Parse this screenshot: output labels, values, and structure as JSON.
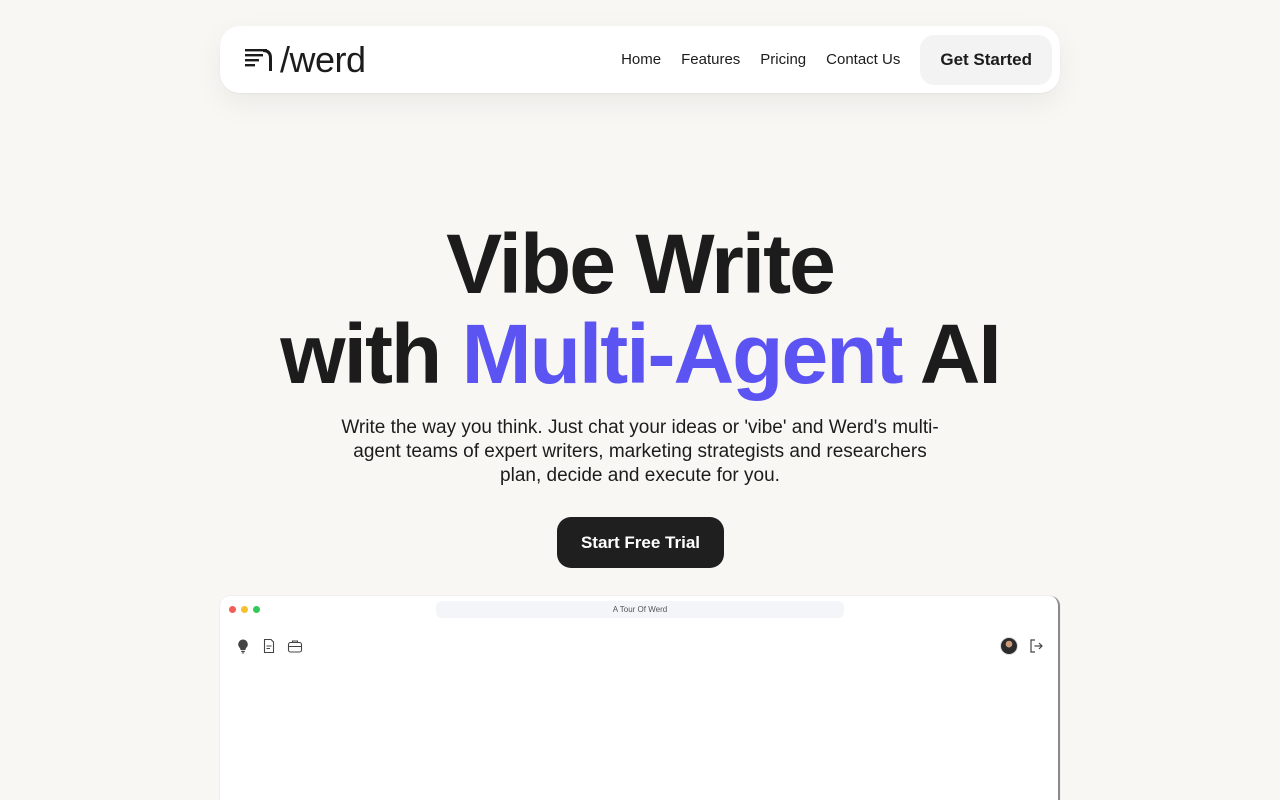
{
  "brand": {
    "name": "/werd"
  },
  "nav": {
    "links": [
      {
        "label": "Home"
      },
      {
        "label": "Features"
      },
      {
        "label": "Pricing"
      },
      {
        "label": "Contact Us"
      }
    ],
    "cta_label": "Get Started"
  },
  "hero": {
    "line1": "Vibe Write",
    "line2_prefix": "with",
    "line2_accent": "Multi-Agent",
    "line2_suffix": "AI",
    "subtitle": "Write the way you think. Just chat your ideas or 'vibe' and Werd's multi-agent teams of expert writers, marketing strategists and researchers plan, decide and execute for you.",
    "cta_label": "Start Free Trial"
  },
  "preview": {
    "window_title": "A Tour Of Werd",
    "left_icons": [
      "lightbulb-icon",
      "document-icon",
      "briefcase-icon"
    ],
    "right_icons": [
      "avatar",
      "logout-icon"
    ]
  },
  "colors": {
    "accent": "#5b53f2",
    "background": "#f8f7f4",
    "primary_button": "#1f1f1f"
  }
}
